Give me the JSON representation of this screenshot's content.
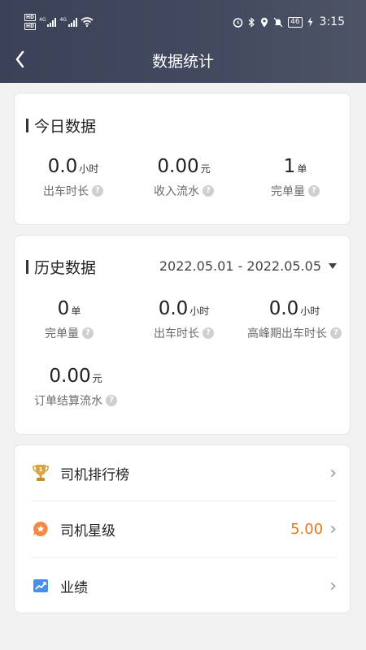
{
  "status_bar": {
    "hd_top": "HD",
    "hd_bottom": "HD",
    "sim1": "4G",
    "sim2": "4G",
    "battery": "46",
    "time": "3:15"
  },
  "nav": {
    "title": "数据统计"
  },
  "today": {
    "title": "今日数据",
    "metrics": [
      {
        "value": "0.0",
        "unit": "小时",
        "label": "出车时长"
      },
      {
        "value": "0.00",
        "unit": "元",
        "label": "收入流水"
      },
      {
        "value": "1",
        "unit": "单",
        "label": "完单量"
      }
    ]
  },
  "history": {
    "title": "历史数据",
    "date_range": "2022.05.01 - 2022.05.05",
    "metrics": [
      {
        "value": "0",
        "unit": "单",
        "label": "完单量"
      },
      {
        "value": "0.0",
        "unit": "小时",
        "label": "出车时长"
      },
      {
        "value": "0.0",
        "unit": "小时",
        "label": "高峰期出车时长"
      },
      {
        "value": "0.00",
        "unit": "元",
        "label": "订单结算流水"
      }
    ]
  },
  "menu": {
    "items": [
      {
        "label": "司机排行榜",
        "icon": "trophy-icon",
        "value": ""
      },
      {
        "label": "司机星级",
        "icon": "star-badge-icon",
        "value": "5.00"
      },
      {
        "label": "业绩",
        "icon": "trend-chart-icon",
        "value": ""
      }
    ]
  },
  "colors": {
    "header": "#3f465b",
    "accent_orange": "#e07a1f",
    "trophy_gold": "#d9a441",
    "chart_blue": "#4a8fe7"
  }
}
